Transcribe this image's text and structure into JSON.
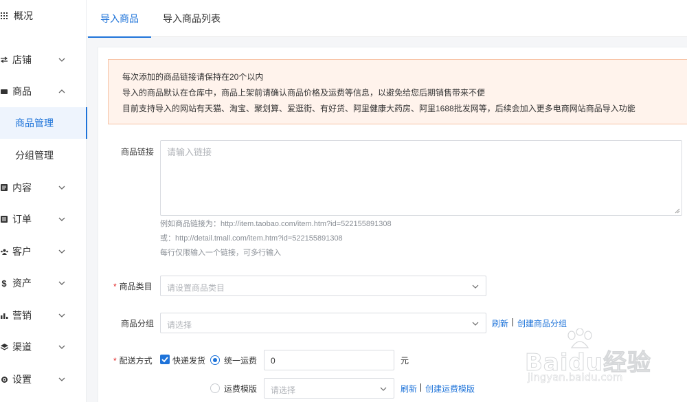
{
  "sidebar": {
    "items": [
      {
        "label": "概况",
        "icon": "grid-icon"
      },
      {
        "label": "店铺",
        "icon": "store-icon"
      },
      {
        "label": "商品",
        "icon": "product-icon"
      },
      {
        "label": "商品管理"
      },
      {
        "label": "分组管理"
      },
      {
        "label": "内容",
        "icon": "content-icon"
      },
      {
        "label": "订单",
        "icon": "order-icon"
      },
      {
        "label": "客户",
        "icon": "customer-icon"
      },
      {
        "label": "资产",
        "icon": "asset-icon"
      },
      {
        "label": "营销",
        "icon": "marketing-icon"
      },
      {
        "label": "渠道",
        "icon": "channel-icon"
      },
      {
        "label": "设置",
        "icon": "settings-icon"
      }
    ],
    "accent": "#1e73d9"
  },
  "tabs": [
    {
      "label": "导入商品"
    },
    {
      "label": "导入商品列表"
    }
  ],
  "notice": {
    "lines": [
      "每次添加的商品链接请保持在20个以内",
      "导入的商品默认在仓库中，商品上架前请确认商品价格及运费等信息，以避免给您后期销售带来不便",
      "目前支持导入的网站有天猫、淘宝、聚划算、爱逛街、有好货、阿里健康大药房、阿里1688批发网等，后续会加入更多电商网站商品导入功能"
    ]
  },
  "form": {
    "link": {
      "label": "商品链接",
      "placeholder": "请输入链接",
      "help": [
        "例如商品链接为：http://item.taobao.com/item.htm?id=522155891308",
        "或：http://detail.tmall.com/item.htm?id=522155891308",
        "每行仅限输入一个链接，可多行输入"
      ]
    },
    "category": {
      "required": "*",
      "label": "商品类目",
      "placeholder": "请设置商品类目"
    },
    "group": {
      "label": "商品分组",
      "placeholder": "请选择",
      "refresh": "刷新",
      "create": "创建商品分组"
    },
    "delivery": {
      "required": "*",
      "label": "配送方式",
      "express": "快递发货",
      "unified_label": "统一运费",
      "unified_value": "0",
      "unit": "元",
      "template_label": "运费模版",
      "template_placeholder": "请选择",
      "refresh": "刷新",
      "create": "创建运费模版"
    }
  },
  "watermark": {
    "brand": "Baidu经验",
    "url": "jingyan.baidu.com"
  }
}
